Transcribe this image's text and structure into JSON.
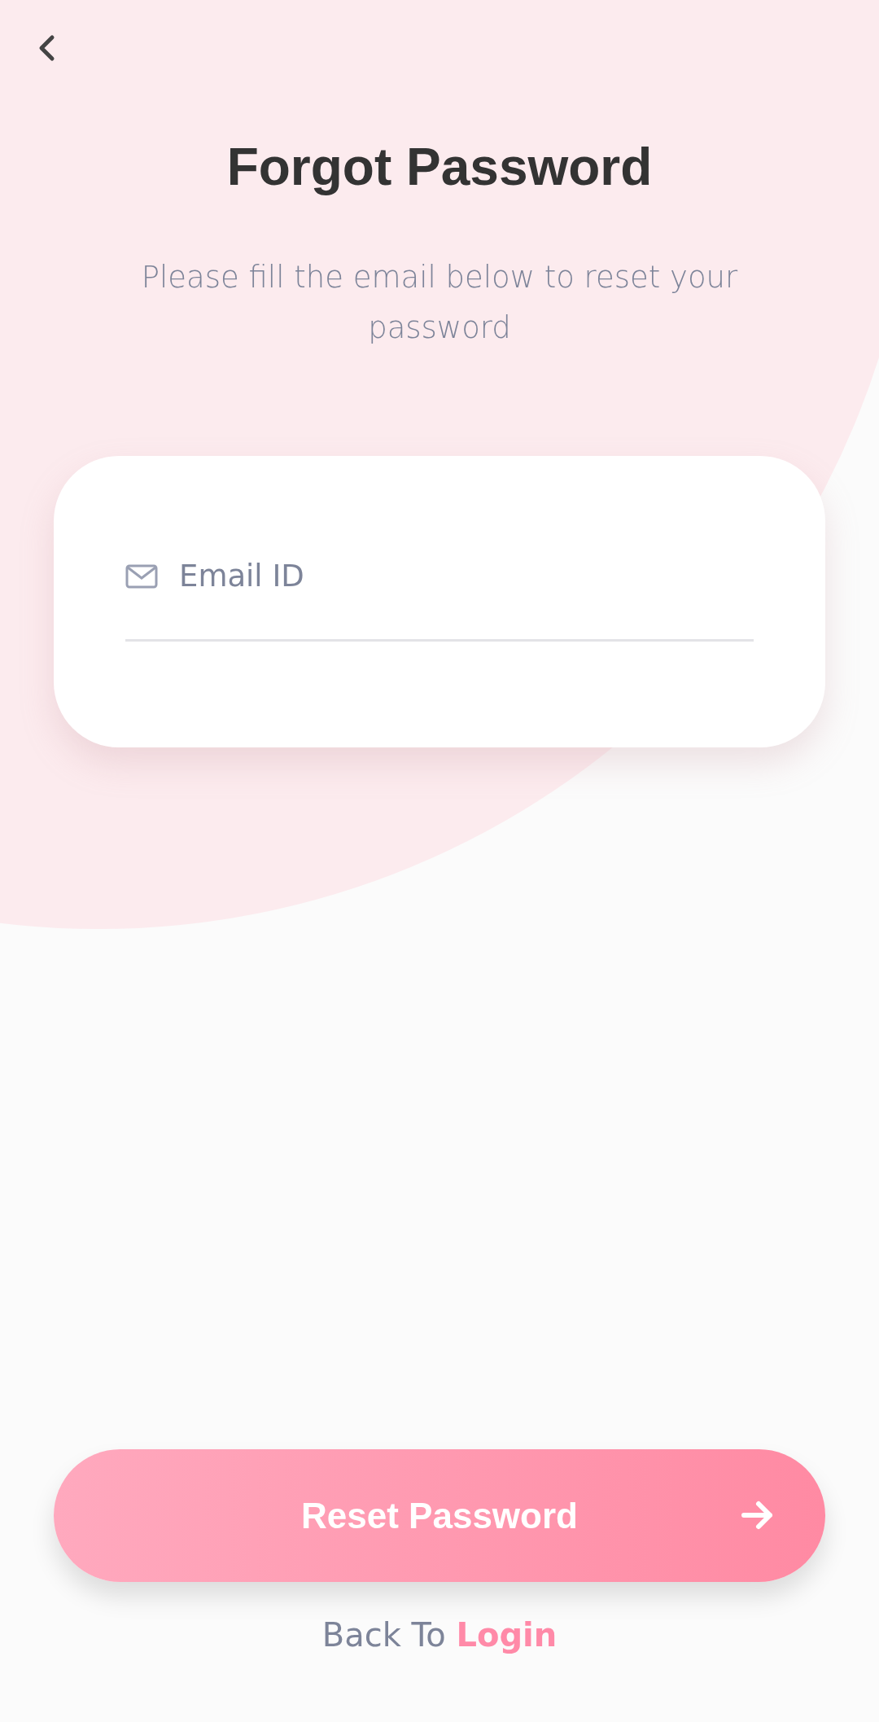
{
  "title": "Forgot Password",
  "subtitle": "Please fill the email below to reset your password",
  "email_field": {
    "placeholder": "Email ID"
  },
  "submit_button": {
    "label": "Reset Password"
  },
  "footer": {
    "text": "Back To",
    "link": "Login"
  }
}
